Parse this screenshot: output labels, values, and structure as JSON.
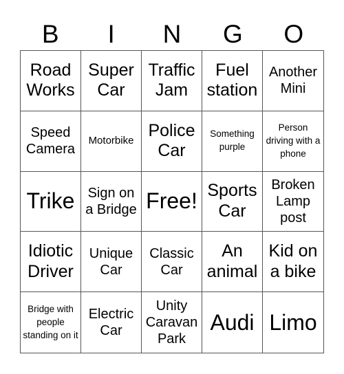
{
  "header": {
    "letters": [
      "B",
      "I",
      "N",
      "G",
      "O"
    ]
  },
  "board": {
    "rows": [
      [
        {
          "text": "Road Works",
          "size": "fs-l"
        },
        {
          "text": "Super Car",
          "size": "fs-l"
        },
        {
          "text": "Traffic Jam",
          "size": "fs-l"
        },
        {
          "text": "Fuel station",
          "size": "fs-l"
        },
        {
          "text": "Another Mini",
          "size": "fs-m"
        }
      ],
      [
        {
          "text": "Speed Camera",
          "size": "fs-m"
        },
        {
          "text": "Motorbike",
          "size": "fs-xs"
        },
        {
          "text": "Police Car",
          "size": "fs-l"
        },
        {
          "text": "Something purple",
          "size": "fs-xxs"
        },
        {
          "text": "Person driving with a phone",
          "size": "fs-xxs"
        }
      ],
      [
        {
          "text": "Trike",
          "size": "fs-xl"
        },
        {
          "text": "Sign on a Bridge",
          "size": "fs-m"
        },
        {
          "text": "Free!",
          "size": "fs-xl"
        },
        {
          "text": "Sports Car",
          "size": "fs-l"
        },
        {
          "text": "Broken Lamp post",
          "size": "fs-m"
        }
      ],
      [
        {
          "text": "Idiotic Driver",
          "size": "fs-l"
        },
        {
          "text": "Unique Car",
          "size": "fs-m"
        },
        {
          "text": "Classic Car",
          "size": "fs-m"
        },
        {
          "text": "An animal",
          "size": "fs-l"
        },
        {
          "text": "Kid on a bike",
          "size": "fs-l"
        }
      ],
      [
        {
          "text": "Bridge with people standing on it",
          "size": "fs-xxs"
        },
        {
          "text": "Electric Car",
          "size": "fs-m"
        },
        {
          "text": "Unity Caravan Park",
          "size": "fs-m"
        },
        {
          "text": "Audi",
          "size": "fs-xl"
        },
        {
          "text": "Limo",
          "size": "fs-xl"
        }
      ]
    ]
  }
}
